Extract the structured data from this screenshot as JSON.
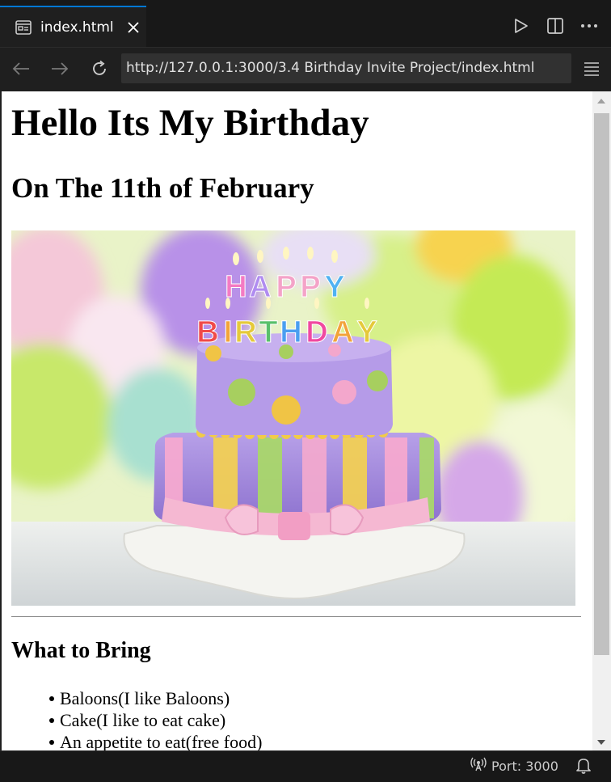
{
  "tab": {
    "label": "index.html"
  },
  "navbar": {
    "url": "http://127.0.0.1:3000/3.4 Birthday Invite Project/index.html"
  },
  "page": {
    "heading": "Hello Its My Birthday",
    "subheading": "On The 11th of February",
    "image_alt": "birthday cake",
    "image_candle_text": "HAPPY BIRTHDAY",
    "section_title": "What to Bring",
    "items": [
      {
        "text": "Baloons(I like Baloons)"
      },
      {
        "text": "Cake(I like to eat cake)"
      },
      {
        "text": "An appetite to eat(free food)"
      }
    ]
  },
  "statusbar": {
    "port": "Port: 3000"
  },
  "icons": {
    "tab": "preview-icon",
    "close": "close-icon",
    "run": "play-icon",
    "split": "split-editor-icon",
    "more": "more-icon",
    "back": "arrow-left-icon",
    "forward": "arrow-right-icon",
    "reload": "reload-icon",
    "menu": "hamburger-menu-icon",
    "port": "radio-tower-icon",
    "bell": "bell-icon"
  },
  "colors": {
    "accent": "#0078d4",
    "chrome": "#1f1f1f",
    "tabbar": "#181818",
    "url_field": "#313131"
  }
}
